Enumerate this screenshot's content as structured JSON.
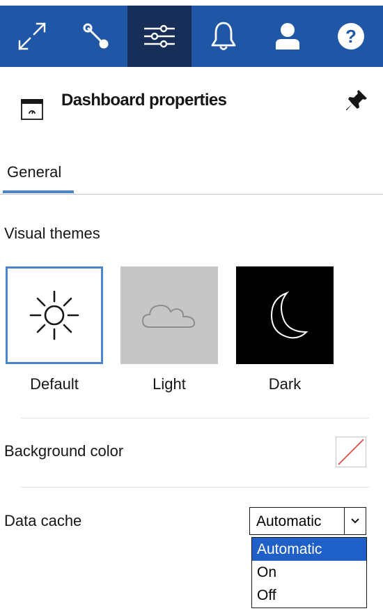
{
  "toolbar": {
    "items": [
      {
        "icon": "expand-icon"
      },
      {
        "icon": "connection-icon"
      },
      {
        "icon": "sliders-icon",
        "active": true
      },
      {
        "icon": "bell-icon"
      },
      {
        "icon": "user-icon"
      },
      {
        "icon": "help-icon"
      }
    ],
    "colors": {
      "background": "#1f57a6",
      "active": "#162e58"
    }
  },
  "panel": {
    "title": "Dashboard properties"
  },
  "tabs": [
    {
      "label": "General",
      "active": true
    }
  ],
  "visual_themes": {
    "label": "Visual themes",
    "options": [
      {
        "label": "Default",
        "icon": "sun-icon",
        "selected": true
      },
      {
        "label": "Light",
        "icon": "cloud-icon",
        "selected": false
      },
      {
        "label": "Dark",
        "icon": "moon-icon",
        "selected": false
      }
    ]
  },
  "background_color": {
    "label": "Background color",
    "value_icon": "no-color-icon"
  },
  "data_cache": {
    "label": "Data cache",
    "selected": "Automatic",
    "options": [
      "Automatic",
      "On",
      "Off"
    ],
    "highlighted": "Automatic"
  },
  "colors": {
    "accent": "#4a86d0",
    "dropdown_highlight": "#1f5fc8"
  }
}
